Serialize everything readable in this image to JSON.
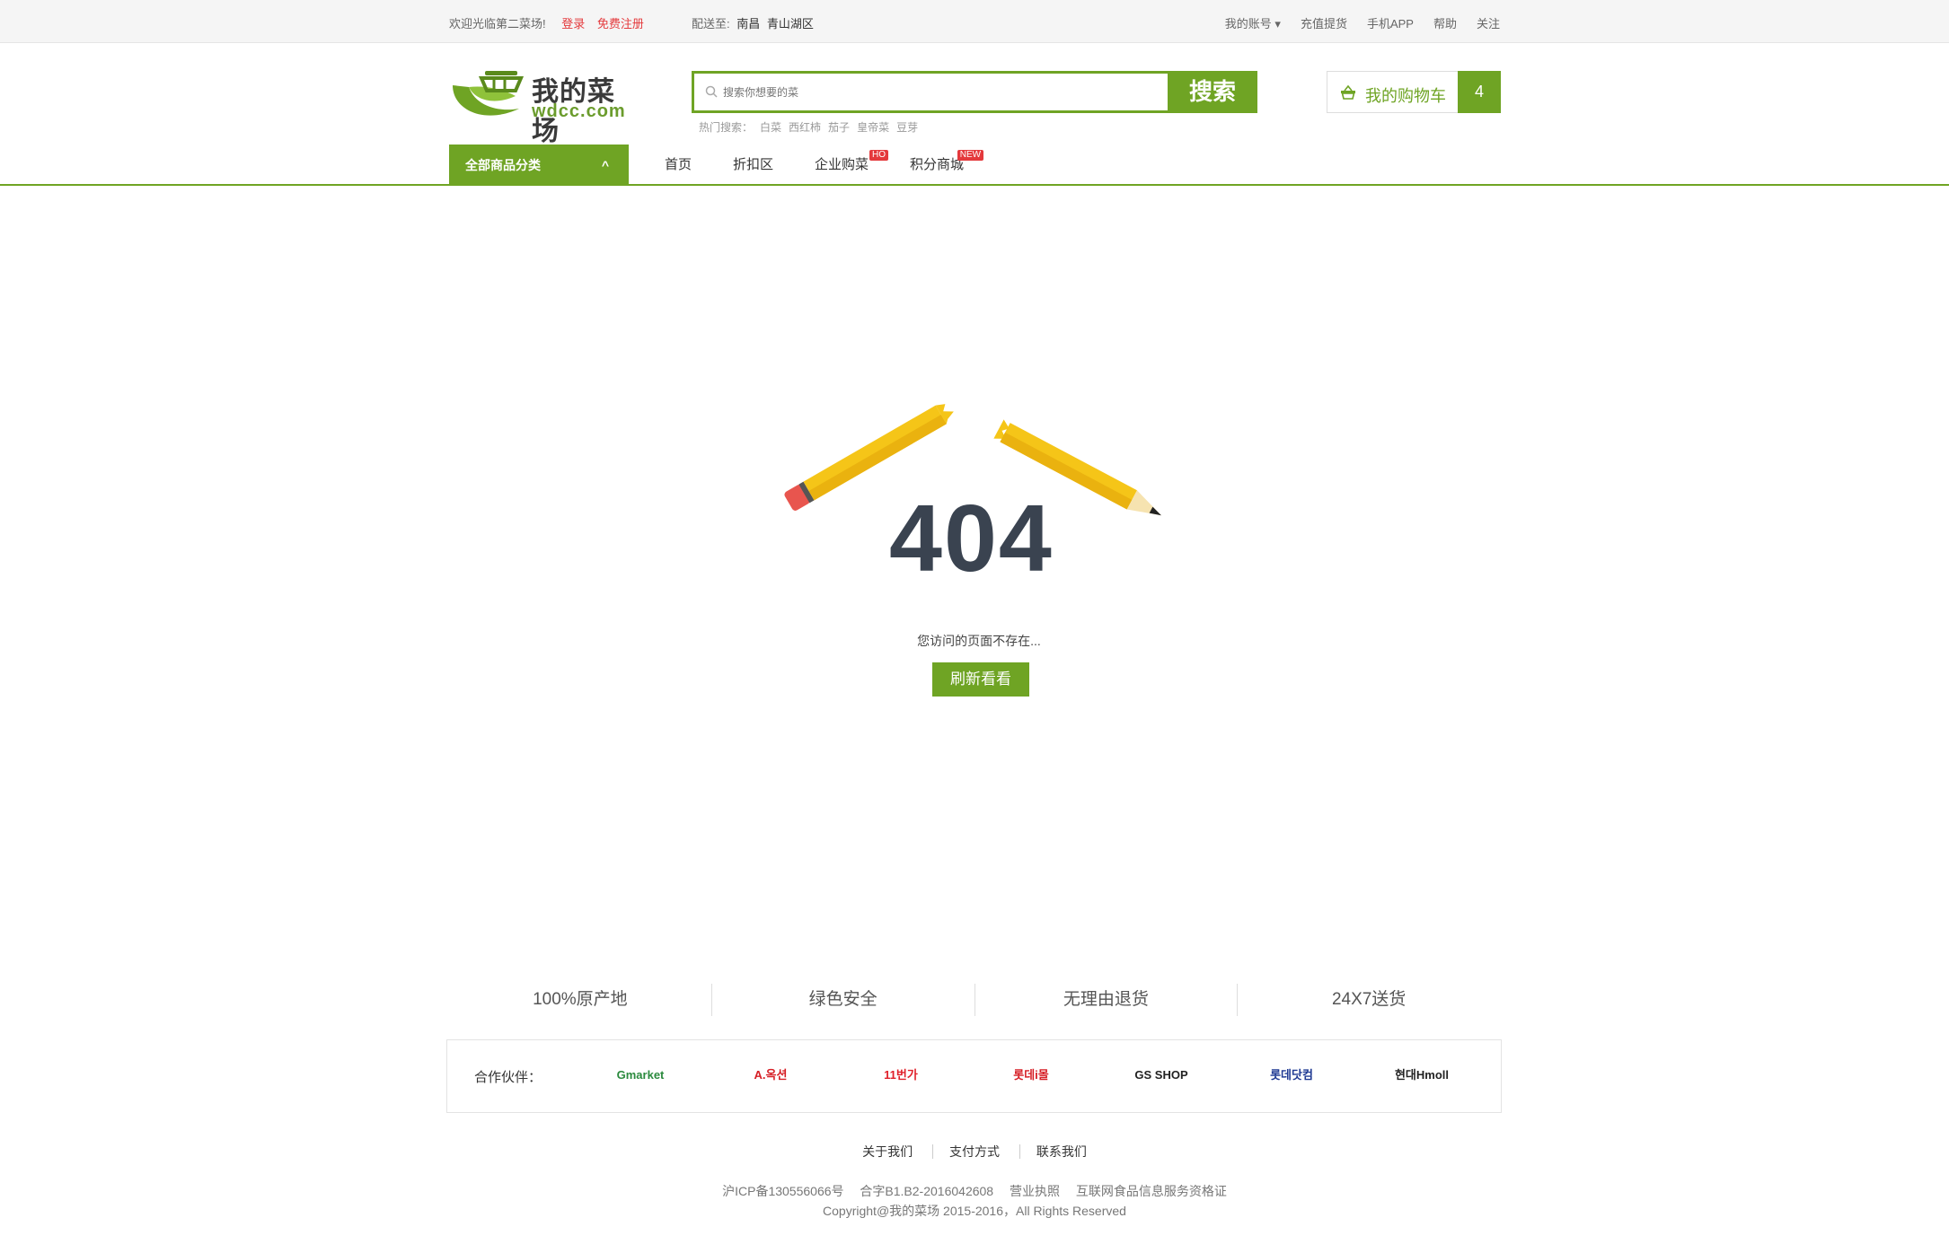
{
  "topbar": {
    "welcome": "欢迎光临第二菜场!",
    "login": "登录",
    "register": "免费注册",
    "deliver_label": "配送至:",
    "deliver_city": "南昌",
    "deliver_district": "青山湖区",
    "links": [
      "我的账号 ▾",
      "充值提货",
      "手机APP",
      "帮助",
      "关注"
    ]
  },
  "logo": {
    "name": "我的菜场",
    "domain": "wdcc.com"
  },
  "search": {
    "placeholder": "搜索你想要的菜",
    "button": "搜索",
    "hot_label": "热门搜索：",
    "hot_items": [
      "白菜",
      "西红柿",
      "茄子",
      "皇帝菜",
      "豆芽"
    ]
  },
  "cart": {
    "label": "我的购物车",
    "count": "4"
  },
  "nav": {
    "all_categories": "全部商品分类",
    "caret": "^",
    "items": [
      {
        "label": "首页",
        "tag": ""
      },
      {
        "label": "折扣区",
        "tag": ""
      },
      {
        "label": "企业购菜",
        "tag": "HO"
      },
      {
        "label": "积分商城",
        "tag": "NEW"
      }
    ]
  },
  "error": {
    "code": "404",
    "message": "您访问的页面不存在...",
    "refresh": "刷新看看"
  },
  "features": [
    "100%原产地",
    "绿色安全",
    "无理由退货",
    "24X7送货"
  ],
  "partners": {
    "label": "合作伙伴：",
    "items": [
      {
        "name": "Gmarket",
        "color": "#2b8a3e"
      },
      {
        "name": "A.옥션",
        "color": "#d61f26"
      },
      {
        "name": "11번가",
        "color": "#e0202a"
      },
      {
        "name": "롯데i몰",
        "color": "#d61f26"
      },
      {
        "name": "GS SHOP",
        "color": "#222222"
      },
      {
        "name": "롯데닷컴",
        "color": "#1f3a93"
      },
      {
        "name": "현대Hmoll",
        "color": "#222222"
      }
    ]
  },
  "footer": {
    "links": [
      "关于我们",
      "支付方式",
      "联系我们"
    ],
    "icp": [
      "沪ICP备130556066号",
      "合字B1.B2-2016042608",
      "营业执照",
      "互联网食品信息服务资格证"
    ],
    "copyright": "Copyright@我的菜场 2015-2016，All Rights Reserved"
  },
  "colors": {
    "brand": "#6fa424",
    "alert": "#e4393c",
    "text_dark": "#3a4350"
  }
}
